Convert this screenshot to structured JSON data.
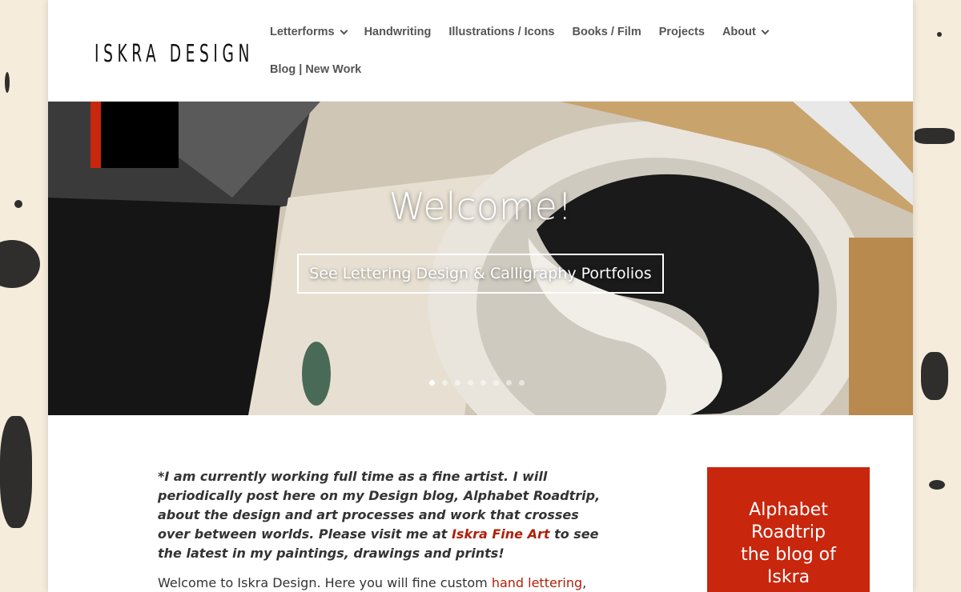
{
  "brand": {
    "logo_text": "ISKRA DESIGN"
  },
  "nav": {
    "row1": [
      {
        "label": "Letterforms",
        "has_dropdown": true
      },
      {
        "label": "Handwriting",
        "has_dropdown": false
      },
      {
        "label": "Illustrations / Icons",
        "has_dropdown": false
      },
      {
        "label": "Books / Film",
        "has_dropdown": false
      },
      {
        "label": "Projects",
        "has_dropdown": false
      },
      {
        "label": "About",
        "has_dropdown": true
      }
    ],
    "row2": [
      {
        "label": "Blog | New Work",
        "has_dropdown": false
      }
    ]
  },
  "hero": {
    "title": "Welcome!",
    "button_label": "See Lettering Design & Calligraphy Portfolios",
    "slide_count": 8,
    "active_slide": 1
  },
  "intro": {
    "text_before": "*I am currently working full time as a fine artist. I will periodically post here on my Design blog, Alphabet Roadtrip, about the design and art processes and work that crosses over between worlds. Please visit me at ",
    "link": "Iskra Fine Art",
    "text_after": " to see the latest in my paintings, drawings and prints!"
  },
  "welcome": {
    "text_before": "Welcome to Iskra Design. Here you will fine custom ",
    "link": "hand lettering",
    "text_after": ","
  },
  "blog_box": {
    "line1": "Alphabet",
    "line2": "Roadtrip",
    "line3": "the blog of",
    "line4": "Iskra"
  },
  "colors": {
    "accent_red": "#c8260d",
    "link_red": "#b0200a",
    "background": "#f5ecdc"
  }
}
